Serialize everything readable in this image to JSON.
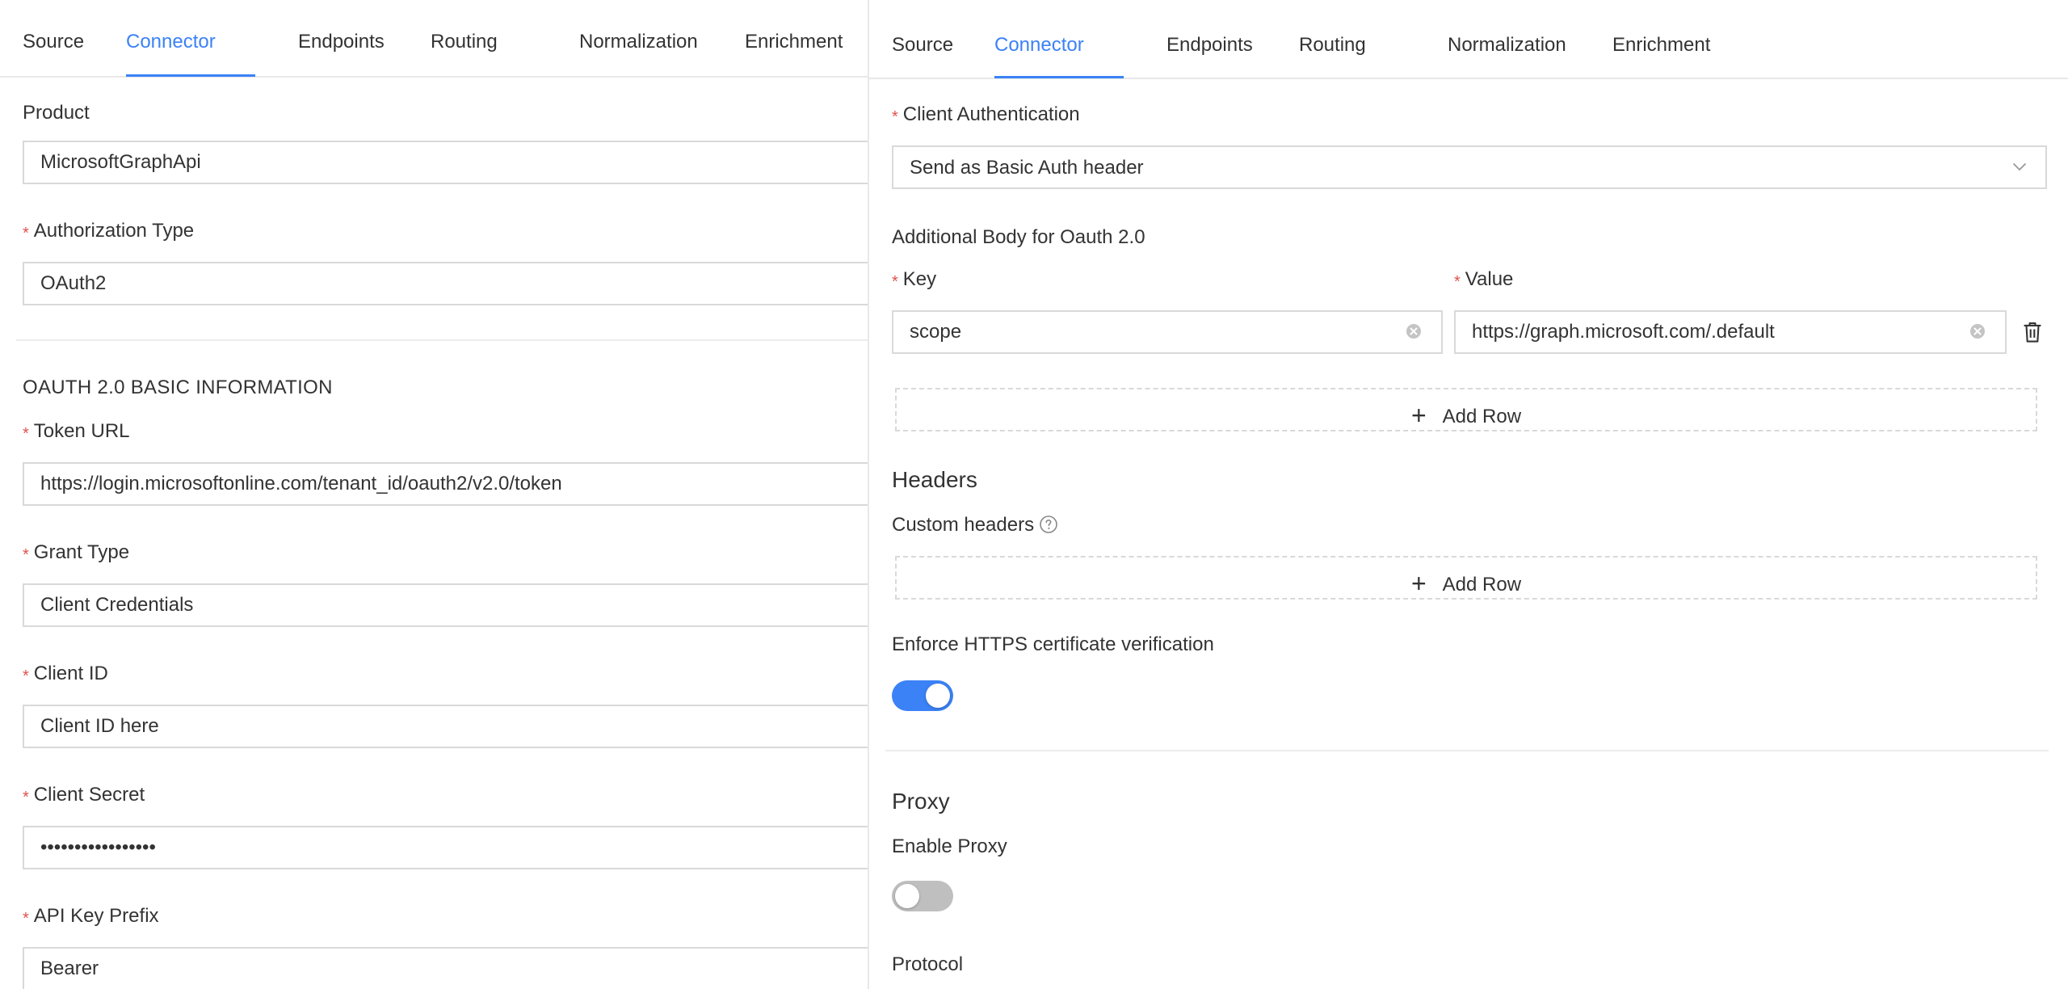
{
  "colors": {
    "accent": "#3b82f6",
    "required": "#e0514f",
    "border": "#d9d9d9",
    "toggle_off": "#bfbfbf"
  },
  "tabs": [
    "Source",
    "Connector",
    "Endpoints",
    "Routing",
    "Normalization",
    "Enrichment"
  ],
  "active_tab": "Connector",
  "left": {
    "product": {
      "label": "Product",
      "value": "MicrosoftGraphApi"
    },
    "auth_type": {
      "label": "Authorization Type",
      "value": "OAuth2"
    },
    "oauth_section_title": "OAUTH 2.0 BASIC INFORMATION",
    "token_url": {
      "label": "Token URL",
      "value": "https://login.microsoftonline.com/tenant_id/oauth2/v2.0/token"
    },
    "grant_type": {
      "label": "Grant Type",
      "value": "Client Credentials"
    },
    "client_id": {
      "label": "Client ID",
      "value": "Client ID here"
    },
    "client_secret": {
      "label": "Client Secret",
      "value": "•••••••••••••••••"
    },
    "api_key_prefix": {
      "label": "API Key Prefix",
      "value": "Bearer"
    }
  },
  "right": {
    "client_auth": {
      "label": "Client Authentication",
      "value": "Send as Basic Auth header"
    },
    "additional_body_label": "Additional Body for Oauth 2.0",
    "key_label": "Key",
    "value_label": "Value",
    "body_row": {
      "key": "scope",
      "value": "https://graph.microsoft.com/.default"
    },
    "add_row_label": "Add Row",
    "headers_heading": "Headers",
    "custom_headers_label": "Custom headers",
    "https_verify": {
      "label": "Enforce HTTPS certificate verification",
      "enabled": true
    },
    "proxy_heading": "Proxy",
    "enable_proxy": {
      "label": "Enable Proxy",
      "enabled": false
    },
    "protocol_label": "Protocol"
  }
}
